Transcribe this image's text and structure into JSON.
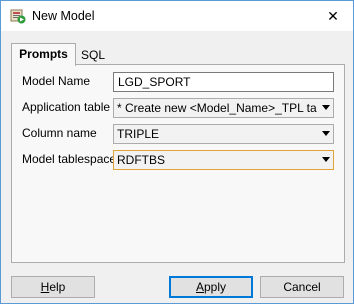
{
  "window": {
    "title": "New Model",
    "close_glyph": "✕",
    "icon": "model-icon"
  },
  "tabs": [
    {
      "label": "Prompts",
      "selected": true
    },
    {
      "label": "SQL",
      "selected": false
    }
  ],
  "form": {
    "model_name": {
      "label": "Model Name",
      "value": "LGD_SPORT"
    },
    "application_table": {
      "label": "Application table",
      "value": "* Create new <Model_Name>_TPL table *"
    },
    "column_name": {
      "label": "Column name",
      "value": "TRIPLE"
    },
    "model_tablespace": {
      "label": "Model tablespace",
      "value": "RDFTBS"
    }
  },
  "buttons": {
    "help": {
      "mnemonic": "H",
      "rest": "elp"
    },
    "apply": {
      "mnemonic": "A",
      "rest": "pply"
    },
    "cancel": {
      "label": "Cancel"
    }
  },
  "colors": {
    "accent": "#0078d7",
    "focus_border": "#e3a33a"
  }
}
